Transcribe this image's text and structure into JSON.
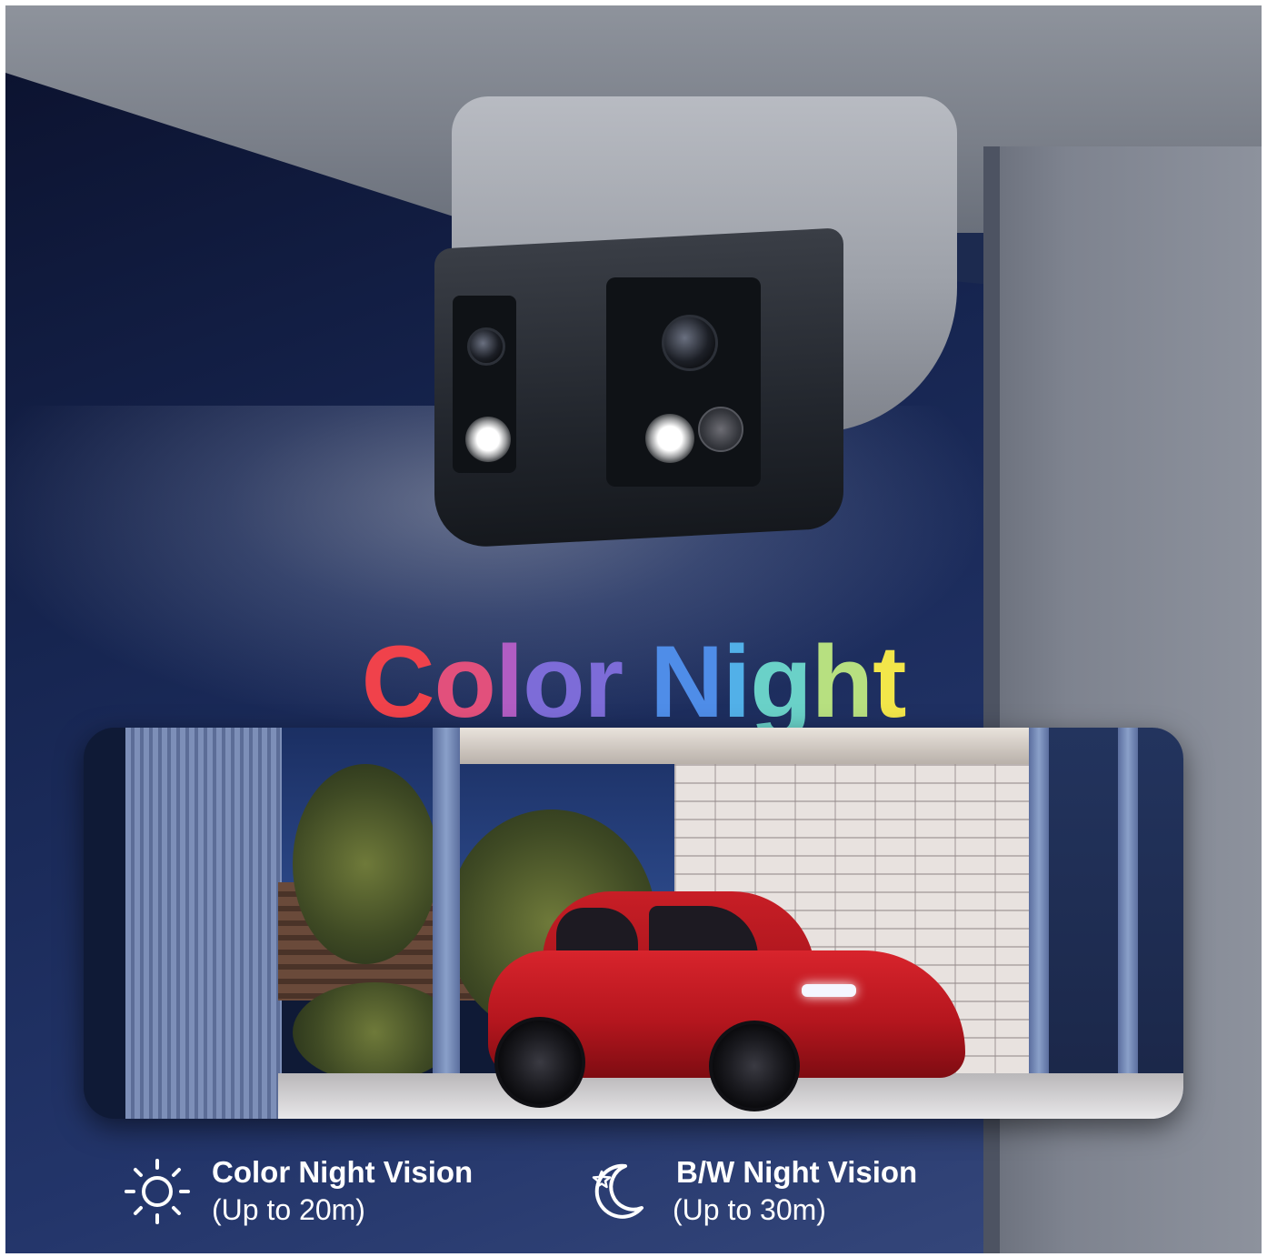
{
  "headline": {
    "word1": [
      "C",
      "o",
      "l",
      "o",
      "r"
    ],
    "word2": [
      "N",
      "i",
      "g",
      "h",
      "t"
    ]
  },
  "features": [
    {
      "icon": "sun-icon",
      "title": "Color Night Vision",
      "subtitle": "(Up to 20m)"
    },
    {
      "icon": "moon-star-icon",
      "title": "B/W Night Vision",
      "subtitle": "(Up to 30m)"
    }
  ],
  "colors": {
    "headline_gradient": [
      "#f0424b",
      "#e2507c",
      "#b15dc3",
      "#7d6cd8",
      "#4f8de8",
      "#52b0e8",
      "#6ad1c8",
      "#b7e080",
      "#f2e64a"
    ],
    "background_night": "#172652",
    "car": "#c81e26",
    "feature_text": "#ffffff"
  }
}
